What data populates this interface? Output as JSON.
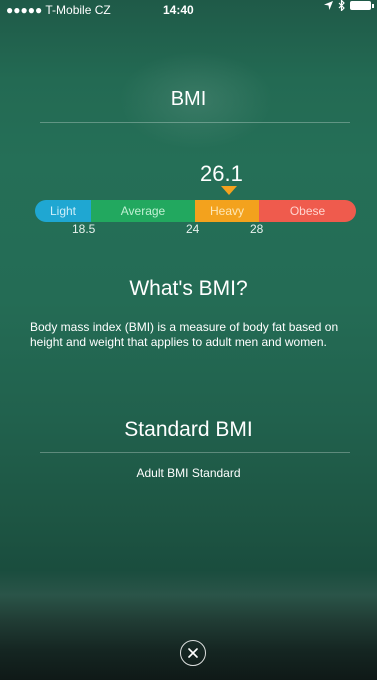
{
  "status_bar": {
    "carrier": "●●●●● T-Mobile CZ",
    "time": "14:40"
  },
  "header": {
    "title": "BMI"
  },
  "bmi_scale": {
    "value": "26.1",
    "segments": [
      {
        "label": "Light",
        "color": "#1fa7d2"
      },
      {
        "label": "Average",
        "color": "#22a85f"
      },
      {
        "label": "Heavy",
        "color": "#f3a21d"
      },
      {
        "label": "Obese",
        "color": "#ef5b4d"
      }
    ],
    "ticks": [
      "18.5",
      "24",
      "28"
    ]
  },
  "about": {
    "title": "What's BMI?",
    "text": "Body mass index (BMI) is a measure of body fat based on height and weight that applies to adult men and women."
  },
  "standard": {
    "title": "Standard BMI",
    "subtitle": "Adult BMI Standard"
  },
  "close_button": {
    "icon": "close-icon"
  }
}
